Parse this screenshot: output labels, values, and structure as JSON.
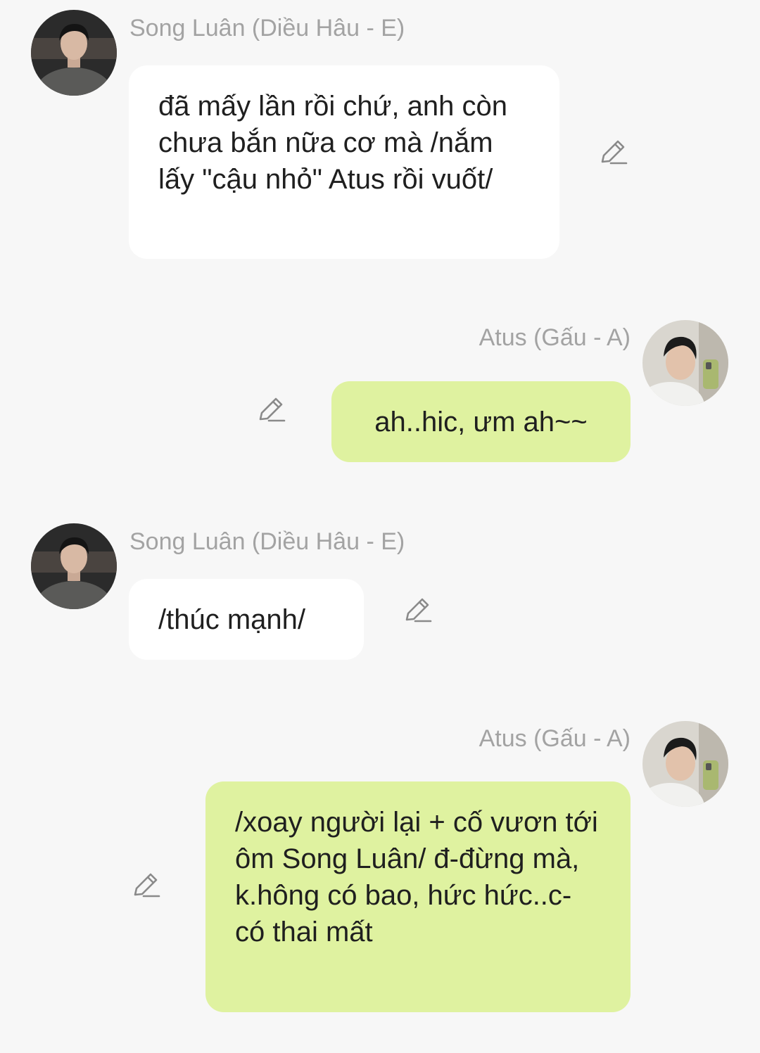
{
  "messages": [
    {
      "side": "left",
      "sender": "Song Luân (Diều Hâu - E)",
      "avatar": "song-luan-avatar",
      "text": "đã mấy lần rồi chứ, anh còn chưa bắn nữa cơ mà /nắm lấy \"cậu nhỏ\" Atus rồi vuốt/"
    },
    {
      "side": "right",
      "sender": "Atus (Gấu - A)",
      "avatar": "atus-avatar",
      "text": "ah..hic, ưm ah~~"
    },
    {
      "side": "left",
      "sender": "Song Luân (Diều Hâu - E)",
      "avatar": "song-luan-avatar",
      "text": "/thúc mạnh/"
    },
    {
      "side": "right",
      "sender": "Atus (Gấu - A)",
      "avatar": "atus-avatar",
      "text": "/xoay người lại + cố vươn tới ôm Song Luân/ đ-đừng mà, k.hông có bao, hức hức..c-có thai mất"
    }
  ],
  "icons": {
    "edit": "pencil-edit-icon"
  },
  "colors": {
    "background": "#f7f7f7",
    "left_bubble": "#ffffff",
    "right_bubble": "#dff2a0",
    "sender_name": "#a3a3a3",
    "message_text": "#1f1f1f",
    "edit_icon": "#8a8a8a"
  }
}
